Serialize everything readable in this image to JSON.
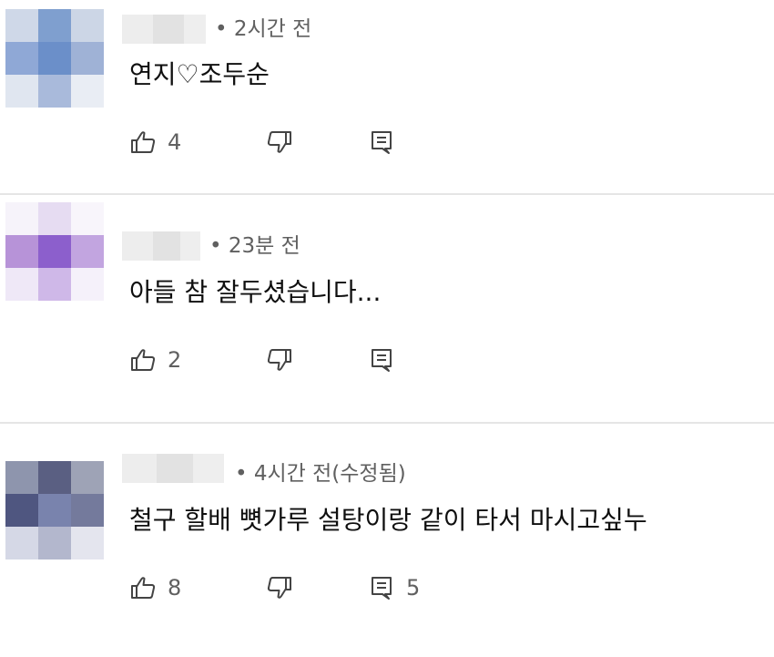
{
  "comments": [
    {
      "avatar_colors": [
        "#cfd8e8",
        "#7f9fcf",
        "#ccd6e6",
        "#8fa8d6",
        "#6b8fc9",
        "#9fb2d6",
        "#e0e6f0",
        "#a9badb",
        "#e9edf4"
      ],
      "time": "• 2시간 전",
      "text": "연지♡조두순",
      "likes": "4",
      "replies": ""
    },
    {
      "avatar_colors": [
        "#f6f3fa",
        "#e6dcf2",
        "#f8f5fb",
        "#b793d8",
        "#8c5fcc",
        "#c2a5e0",
        "#efe8f7",
        "#cfb8e8",
        "#f5f1fa"
      ],
      "time": "• 23분 전",
      "text": "아들 참 잘두셨습니다...",
      "likes": "2",
      "replies": ""
    },
    {
      "avatar_colors": [
        "#8e95ad",
        "#5a5f82",
        "#9ea3b6",
        "#4f5680",
        "#7983ad",
        "#747a9c",
        "#d5d8e6",
        "#b3b7cd",
        "#e4e5ee"
      ],
      "time": "• 4시간 전(수정됨)",
      "text": "철구 할배 뼛가루 설탕이랑 같이 타서 마시고싶누",
      "likes": "8",
      "replies": "5"
    }
  ],
  "colors": {
    "name_blur_a": "#ebebeb",
    "name_blur_b": "#e0e0e0",
    "icon": "#444444",
    "meta": "#606060",
    "divider": "#e5e5e5"
  },
  "icons": {
    "like": "thumb-up-icon",
    "dislike": "thumb-down-icon",
    "reply": "reply-icon"
  }
}
